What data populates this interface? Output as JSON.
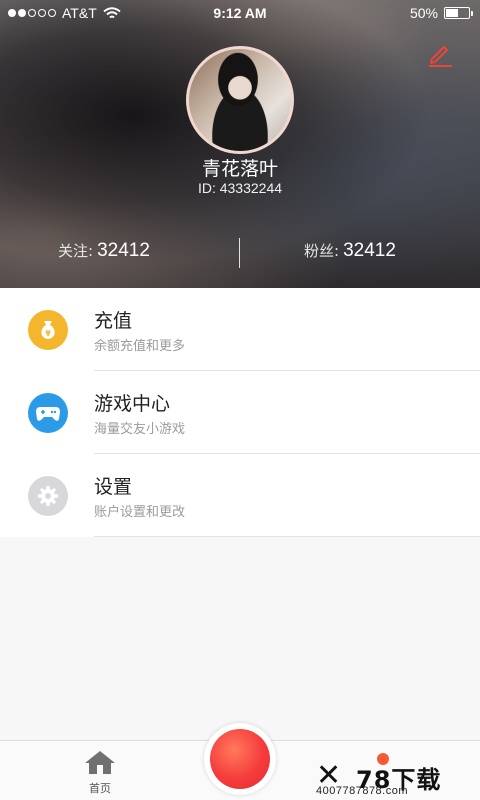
{
  "status_bar": {
    "carrier": "AT&T",
    "time": "9:12 AM",
    "battery_text": "50%",
    "battery_level": 0.5,
    "signal_bars_filled": 2,
    "signal_bars_total": 5
  },
  "profile": {
    "name": "青花落叶",
    "id_text": "ID: 43332244",
    "edit_icon": "pencil-icon"
  },
  "stats": {
    "follow_label": "关注:",
    "follow_value": "32412",
    "fans_label": "粉丝:",
    "fans_value": "32412"
  },
  "menu": [
    {
      "title": "充值",
      "subtitle": "余额充值和更多",
      "icon": "money-bag-icon",
      "color": "#f4b62c"
    },
    {
      "title": "游戏中心",
      "subtitle": "海量交友小游戏",
      "icon": "gamepad-icon",
      "color": "#2b9be8"
    },
    {
      "title": "设置",
      "subtitle": "账户设置和更改",
      "icon": "gear-icon",
      "color": "#d8d8dc"
    }
  ],
  "tabbar": {
    "home_label": "首页"
  },
  "watermark": {
    "mark": "✕",
    "brand": "78下载",
    "url": "4007787878.com"
  },
  "colors": {
    "accent_red": "#f53c3c",
    "edit_icon_color": "#e8463a"
  }
}
